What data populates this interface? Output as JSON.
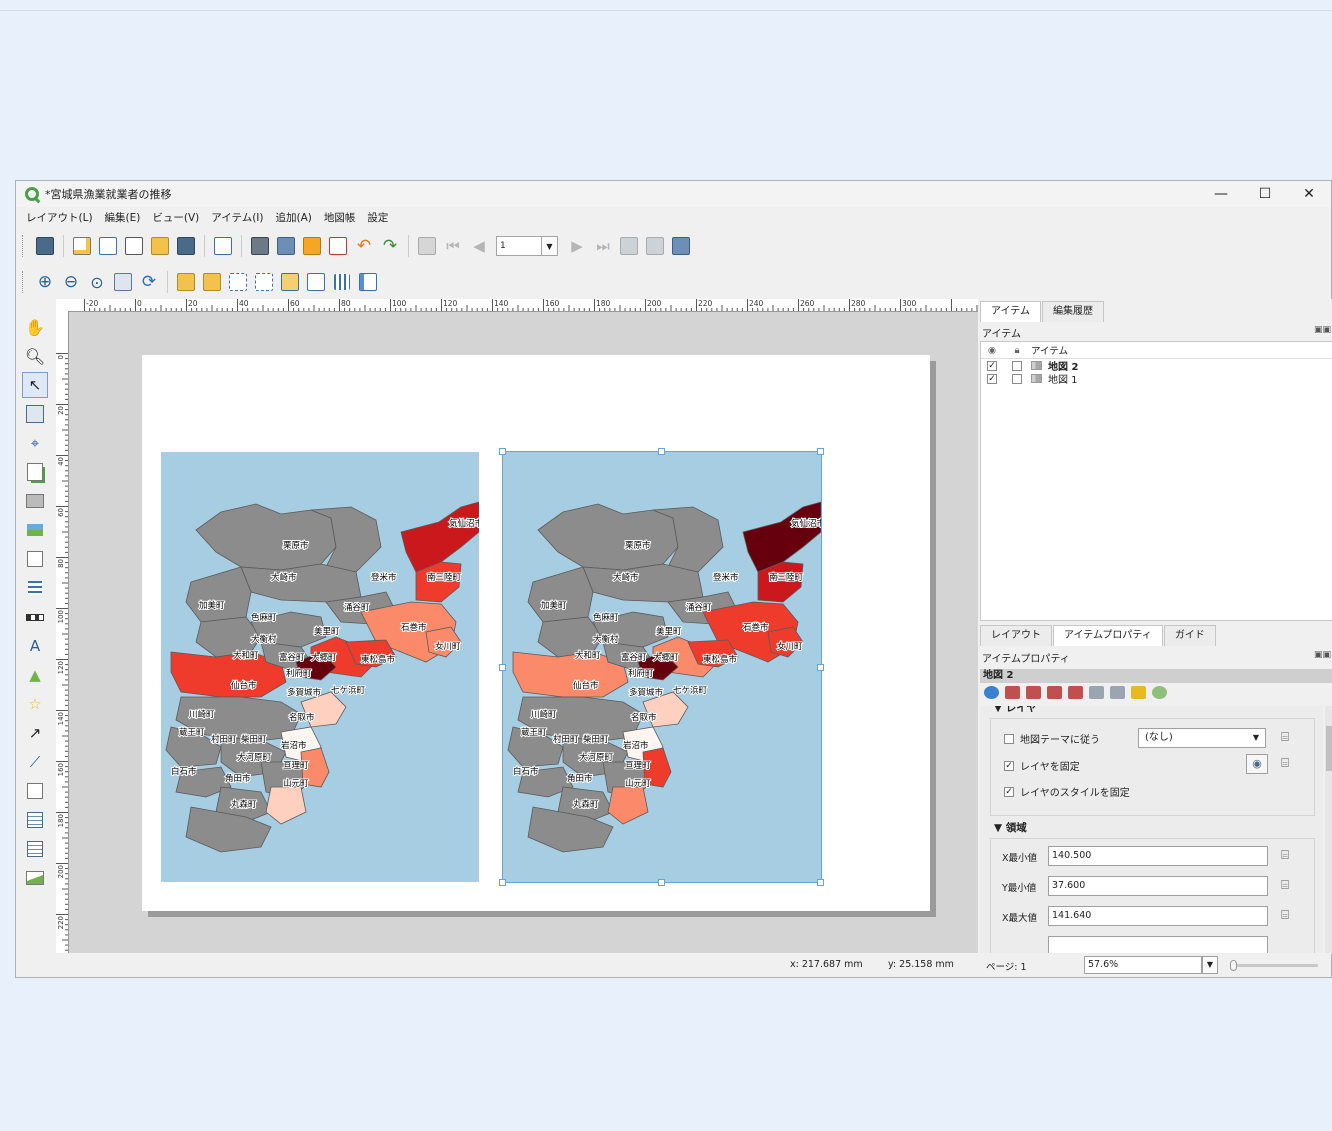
{
  "window": {
    "title": "*宮城県漁業就業者の推移",
    "controls": [
      "—",
      "☐",
      "✕"
    ]
  },
  "menu": [
    "レイアウト(L)",
    "編集(E)",
    "ビュー(V)",
    "アイテム(I)",
    "追加(A)",
    "地図帳",
    "設定"
  ],
  "toolbar": {
    "page_value": "1",
    "icons_row1": [
      "save-layout-icon",
      "new-layout-icon",
      "duplicate-layout-icon",
      "layout-manager-icon",
      "open-template-icon",
      "save-template-icon",
      "page-setup-icon",
      "print-icon",
      "export-image-icon",
      "export-svg-icon",
      "export-pdf-icon",
      "undo-icon",
      "redo-icon",
      "atlas-preview-icon",
      "first-feature-icon",
      "previous-feature-icon",
      "next-feature-icon",
      "last-feature-icon",
      "print-atlas-icon",
      "export-atlas-icon",
      "atlas-settings-icon"
    ],
    "icons_row2": [
      "zoom-in-icon",
      "zoom-out-icon",
      "zoom-full-icon",
      "zoom-all-icon",
      "refresh-icon",
      "lock-items-icon",
      "unlock-items-icon",
      "group-icon",
      "ungroup-icon",
      "raise-icon",
      "lower-icon",
      "align-icon",
      "distribute-icon"
    ]
  },
  "left_tools": [
    "pan-icon",
    "zoom-tool-icon",
    "select-move-icon",
    "move-content-icon",
    "edit-nodes-icon",
    "add-map-icon",
    "add-3d-map-icon",
    "add-picture-icon",
    "add-label-icon",
    "add-legend-icon",
    "add-scalebar-icon",
    "add-north-arrow-icon",
    "add-shape-icon",
    "add-marker-icon",
    "add-arrow-icon",
    "add-polyline-icon",
    "add-html-icon",
    "add-attribute-table-icon",
    "add-fixed-table-icon",
    "add-elevation-profile-icon"
  ],
  "ruler": {
    "h_labels": [
      "-20",
      "0",
      "20",
      "40",
      "60",
      "80",
      "100",
      "120",
      "140",
      "160",
      "180",
      "200",
      "220",
      "240",
      "260",
      "280",
      "300"
    ],
    "v_labels": [
      "0",
      "20",
      "40",
      "60",
      "80",
      "100",
      "120",
      "140",
      "160",
      "180",
      "200",
      "220"
    ]
  },
  "maps": {
    "map1_labels": [
      "気仙沼市",
      "栗原市",
      "登米市",
      "南三陸町",
      "大崎市",
      "加美町",
      "涌谷町",
      "色麻町",
      "美里町",
      "石巻市",
      "大衡村",
      "女川町",
      "大和町",
      "富谷町",
      "大郷町",
      "東松島市",
      "利府町",
      "仙台市",
      "多賀城市",
      "七ケ浜町",
      "川崎町",
      "名取市",
      "蔵王町",
      "村田町",
      "柴田町",
      "岩沼市",
      "大河原町",
      "亘理町",
      "白石市",
      "角田市",
      "山元町",
      "丸森町"
    ],
    "map2_labels": [
      "気仙沼市",
      "栗原市",
      "登米市",
      "南三陸町",
      "大崎市",
      "加美町",
      "涌谷町",
      "色麻町",
      "美里町",
      "石巻市",
      "大衡村",
      "女川町",
      "大和町",
      "富谷町",
      "大郷町",
      "東松島市",
      "利府町",
      "仙台市",
      "多賀城市",
      "七ケ浜町",
      "川崎町",
      "名取市",
      "蔵王町",
      "村田町",
      "柴田町",
      "岩沼市",
      "大河原町",
      "亘理町",
      "白石市",
      "角田市",
      "山元町",
      "丸森町"
    ],
    "colors": {
      "sea": "#a6cde2",
      "land": "#8c8c8c",
      "darkest": "#67000d",
      "dark": "#cb181d",
      "mid": "#ef3b2c",
      "light": "#fb8a6a",
      "pale": "#fdd0c0",
      "white": "#fff5f0"
    }
  },
  "items_panel": {
    "tabs": [
      "アイテム",
      "編集履歴"
    ],
    "title": "アイテム",
    "column": "アイテム",
    "rows": [
      {
        "name": "地図 2",
        "visible": true,
        "locked": false,
        "bold": true
      },
      {
        "name": "地図 1",
        "visible": true,
        "locked": false,
        "bold": false
      }
    ]
  },
  "props_panel": {
    "tabs": [
      "レイアウト",
      "アイテムプロパティ",
      "ガイド"
    ],
    "title": "アイテムプロパティ",
    "item_name": "地図 2",
    "layers_section": "レイヤ",
    "follow_theme_label": "地図テーマに従う",
    "theme_value": "(なし)",
    "lock_layers_label": "レイヤを固定",
    "lock_styles_label": "レイヤのスタイルを固定",
    "extent_section": "領域",
    "xmin_label": "X最小値",
    "xmin_value": "140.500",
    "ymin_label": "Y最小値",
    "ymin_value": "37.600",
    "xmax_label": "X最大値",
    "xmax_value": "141.640"
  },
  "status": {
    "x": "x: 217.687 mm",
    "y": "y: 25.158 mm",
    "page": "ページ: 1",
    "zoom": "57.6%"
  }
}
